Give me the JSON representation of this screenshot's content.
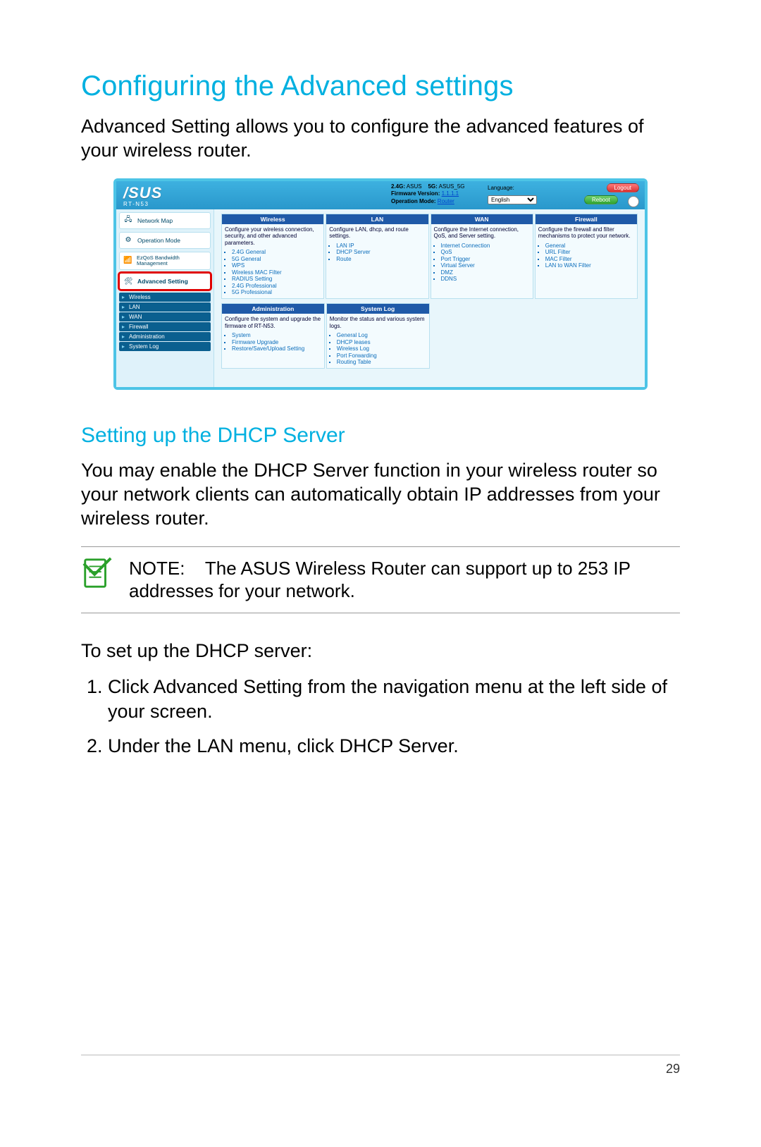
{
  "page": {
    "title": "Configuring the Advanced settings",
    "intro": "Advanced Setting allows you to configure the advanced features of your wireless router.",
    "subhead": "Setting up the DHCP Server",
    "subintro": "You may enable the DHCP Server function in your wireless router so your network clients can automatically obtain IP addresses from your wireless router.",
    "note_label": "NOTE:",
    "note_text": "The ASUS Wireless Router can support up to 253 IP addresses for your network.",
    "steps_intro": "To set up the DHCP server:",
    "steps": [
      "Click Advanced Setting from the navigation menu at the left side of your screen.",
      "Under the LAN menu, click DHCP Server."
    ],
    "number": "29"
  },
  "router": {
    "brand": "/SUS",
    "model": "RT-N53",
    "header": {
      "ssid24_label": "2.4G:",
      "ssid24": "ASUS",
      "ssid5_label": "5G:",
      "ssid5": "ASUS_5G",
      "fw_label": "Firmware Version:",
      "fw": "1.1.1.1",
      "mode_label": "Operation Mode:",
      "mode": "Router",
      "lang_label": "Language:",
      "lang_value": "English",
      "logout": "Logout",
      "reboot": "Reboot"
    },
    "sidebar": {
      "network_map": "Network Map",
      "operation_mode": "Operation Mode",
      "ezqos": "EzQoS Bandwidth Management",
      "advanced": "Advanced Setting",
      "subitems": [
        "Wireless",
        "LAN",
        "WAN",
        "Firewall",
        "Administration",
        "System Log"
      ]
    },
    "cards": {
      "wireless": {
        "title": "Wireless",
        "desc": "Configure your wireless connection, security, and other advanced parameters.",
        "items": [
          "2.4G General",
          "5G General",
          "WPS",
          "Wireless MAC Filter",
          "RADIUS Setting",
          "2.4G Professional",
          "5G Professional"
        ]
      },
      "lan": {
        "title": "LAN",
        "desc": "Configure LAN, dhcp, and route settings.",
        "items": [
          "LAN IP",
          "DHCP Server",
          "Route"
        ]
      },
      "wan": {
        "title": "WAN",
        "desc": "Configure the Internet connection, QoS, and Server setting.",
        "items": [
          "Internet Connection",
          "QoS",
          "Port Trigger",
          "Virtual Server",
          "DMZ",
          "DDNS"
        ]
      },
      "firewall": {
        "title": "Firewall",
        "desc": "Configure the firewall and filter mechanisms to protect your network.",
        "items": [
          "General",
          "URL Filter",
          "MAC Filter",
          "LAN to WAN Filter"
        ]
      },
      "admin": {
        "title": "Administration",
        "desc": "Configure the system and upgrade the firmware of RT-N53.",
        "items": [
          "System",
          "Firmware Upgrade",
          "Restore/Save/Upload Setting"
        ]
      },
      "syslog": {
        "title": "System Log",
        "desc": "Monitor the status and various system logs.",
        "items": [
          "General Log",
          "DHCP leases",
          "Wireless Log",
          "Port Forwarding",
          "Routing Table"
        ]
      }
    }
  }
}
